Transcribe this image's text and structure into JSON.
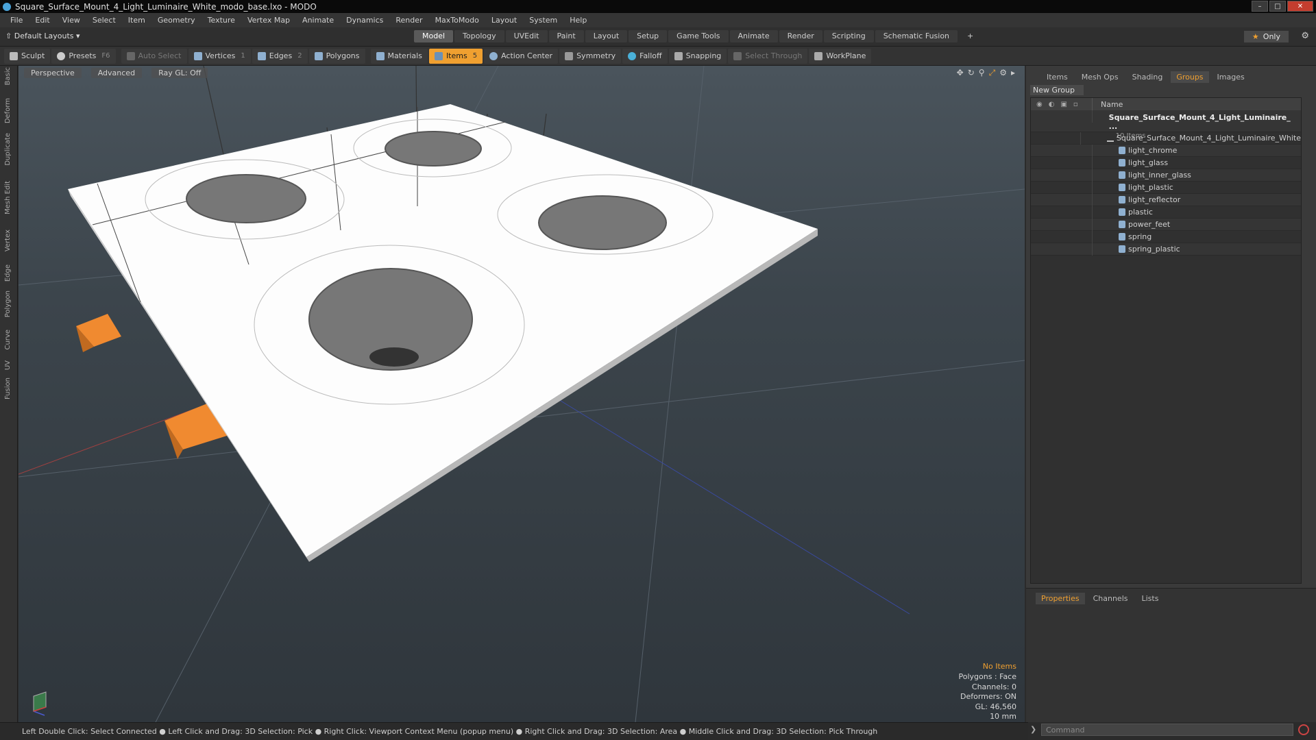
{
  "titlebar": {
    "title": "Square_Surface_Mount_4_Light_Luminaire_White_modo_base.lxo - MODO"
  },
  "menu": [
    "File",
    "Edit",
    "View",
    "Select",
    "Item",
    "Geometry",
    "Texture",
    "Vertex Map",
    "Animate",
    "Dynamics",
    "Render",
    "MaxToModo",
    "Layout",
    "System",
    "Help"
  ],
  "layout": {
    "default_layouts": "Default Layouts",
    "tabs": [
      "Model",
      "Topology",
      "UVEdit",
      "Paint",
      "Layout",
      "Setup",
      "Game Tools",
      "Animate",
      "Render",
      "Scripting",
      "Schematic Fusion"
    ],
    "active_tab": "Model",
    "only_label": "Only"
  },
  "toolbar": {
    "sculpt": "Sculpt",
    "presets": "Presets",
    "presets_key": "F6",
    "auto_select": "Auto Select",
    "vertices": "Vertices",
    "vertices_count": "1",
    "edges": "Edges",
    "edges_count": "2",
    "polygons": "Polygons",
    "materials": "Materials",
    "items": "Items",
    "items_count": "5",
    "action_center": "Action Center",
    "symmetry": "Symmetry",
    "falloff": "Falloff",
    "snapping": "Snapping",
    "select_through": "Select Through",
    "workplane": "WorkPlane"
  },
  "left_tabs": [
    "Basic",
    "Deform",
    "Duplicate",
    "Mesh Edit",
    "Vertex",
    "Edge",
    "Polygon",
    "Curve",
    "UV",
    "Fusion"
  ],
  "viewport": {
    "perspective": "Perspective",
    "advanced": "Advanced",
    "raygl": "Ray GL: Off",
    "info": {
      "no_items": "No Items",
      "polygons": "Polygons : Face",
      "channels": "Channels: 0",
      "deformers": "Deformers: ON",
      "gl": "GL: 46,560",
      "scale": "10 mm"
    }
  },
  "statusbar": {
    "text": "Left Double Click: Select Connected ● Left Click and Drag: 3D Selection: Pick ● Right Click: Viewport Context Menu (popup menu) ● Right Click and Drag: 3D Selection: Area ● Middle Click and Drag: 3D Selection: Pick Through"
  },
  "rightpanel": {
    "tabs": [
      "Items",
      "Mesh Ops",
      "Shading",
      "Groups",
      "Images"
    ],
    "active_tab": "Groups",
    "new_group": "New Group",
    "name_header": "Name",
    "root_name": "Square_Surface_Mount_4_Light_Luminaire_ ...",
    "root_sub": "10 Items",
    "items": [
      {
        "name": "Square_Surface_Mount_4_Light_Luminaire_White",
        "kind": "locator"
      },
      {
        "name": "light_chrome",
        "kind": "mesh"
      },
      {
        "name": "light_glass",
        "kind": "mesh"
      },
      {
        "name": "light_inner_glass",
        "kind": "mesh"
      },
      {
        "name": "light_plastic",
        "kind": "mesh"
      },
      {
        "name": "light_reflector",
        "kind": "mesh"
      },
      {
        "name": "plastic",
        "kind": "mesh"
      },
      {
        "name": "power_feet",
        "kind": "mesh"
      },
      {
        "name": "spring",
        "kind": "mesh"
      },
      {
        "name": "spring_plastic",
        "kind": "mesh"
      }
    ],
    "props_tabs": [
      "Properties",
      "Channels",
      "Lists"
    ],
    "props_active": "Properties"
  },
  "command": {
    "placeholder": "Command"
  },
  "colors": {
    "accent": "#f0a030",
    "background": "#2b2b2b",
    "viewport_top": "#4a545c"
  }
}
